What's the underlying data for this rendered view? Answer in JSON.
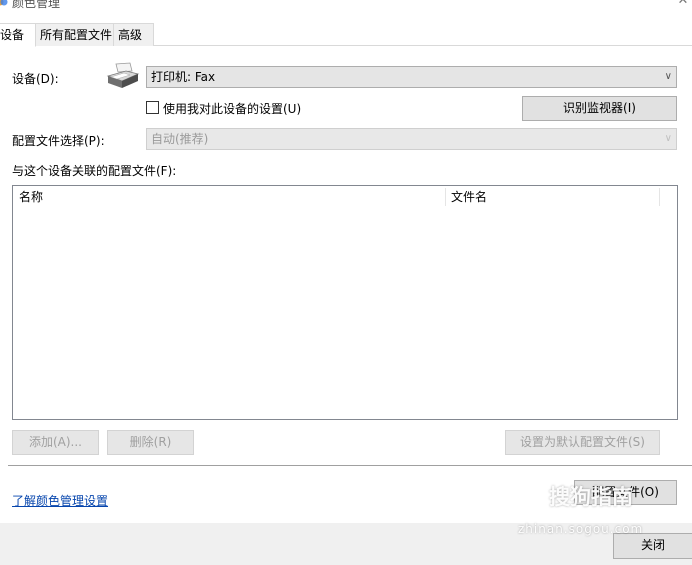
{
  "window": {
    "title": "颜色管理",
    "close_glyph": "✕"
  },
  "tabs": [
    {
      "label": "设备",
      "active": true
    },
    {
      "label": "所有配置文件",
      "active": false
    },
    {
      "label": "高级",
      "active": false
    }
  ],
  "device": {
    "label": "设备(D):",
    "selected": "打印机: Fax",
    "icon": "printer-icon",
    "use_settings_checkbox": {
      "label": "使用我对此设备的设置(U)",
      "checked": false
    },
    "identify_button": "识别监视器(I)"
  },
  "profile_selection": {
    "label": "配置文件选择(P):",
    "selected": "自动(推荐)",
    "enabled": false
  },
  "associated_profiles": {
    "label": "与这个设备关联的配置文件(F):",
    "columns": [
      "名称",
      "文件名"
    ],
    "rows": []
  },
  "actions": {
    "add": "添加(A)...",
    "remove": "删除(R)",
    "set_default": "设置为默认配置文件(S)",
    "profiles": "配置文件(O)"
  },
  "help_link": "了解颜色管理设置",
  "footer": {
    "close_button": "关闭"
  },
  "watermark": {
    "brand": "搜狗指南",
    "url": "zhinan.sogou.com"
  }
}
